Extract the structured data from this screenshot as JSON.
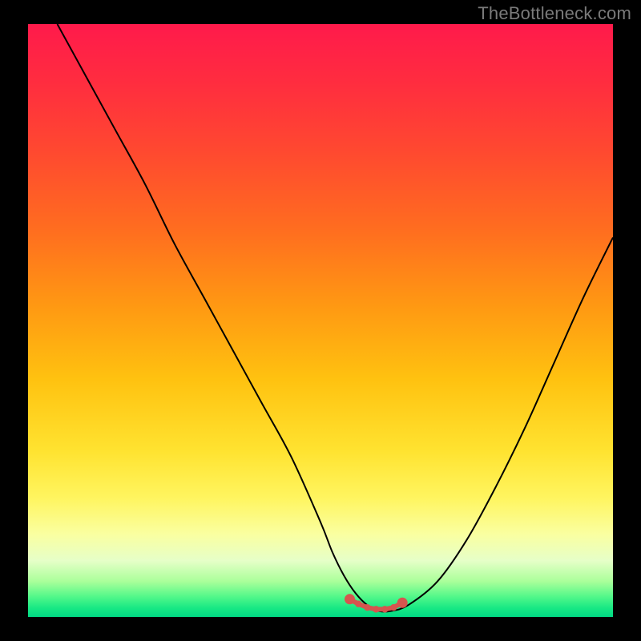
{
  "watermark": "TheBottleneck.com",
  "colors": {
    "frame": "#000000",
    "curve": "#000000",
    "marker_fill": "#d6554f",
    "marker_stroke": "#c23d32",
    "gradient": [
      {
        "offset": 0.0,
        "color": "#ff1a4b"
      },
      {
        "offset": 0.1,
        "color": "#ff2d3f"
      },
      {
        "offset": 0.22,
        "color": "#ff4a2f"
      },
      {
        "offset": 0.35,
        "color": "#ff6e1f"
      },
      {
        "offset": 0.48,
        "color": "#ff9a12"
      },
      {
        "offset": 0.6,
        "color": "#ffc210"
      },
      {
        "offset": 0.72,
        "color": "#ffe330"
      },
      {
        "offset": 0.8,
        "color": "#fff560"
      },
      {
        "offset": 0.86,
        "color": "#faffa0"
      },
      {
        "offset": 0.905,
        "color": "#e6ffc8"
      },
      {
        "offset": 0.94,
        "color": "#aaff9a"
      },
      {
        "offset": 0.965,
        "color": "#55f88a"
      },
      {
        "offset": 0.985,
        "color": "#18e884"
      },
      {
        "offset": 1.0,
        "color": "#00d884"
      }
    ]
  },
  "chart_data": {
    "type": "line",
    "title": "",
    "xlabel": "",
    "ylabel": "",
    "xlim": [
      0,
      100
    ],
    "ylim": [
      0,
      100
    ],
    "series": [
      {
        "name": "bottleneck-curve",
        "x": [
          5,
          10,
          15,
          20,
          25,
          30,
          35,
          40,
          45,
          50,
          52,
          54,
          56,
          58,
          60,
          62,
          65,
          70,
          75,
          80,
          85,
          90,
          95,
          100
        ],
        "y": [
          100,
          91,
          82,
          73,
          63,
          54,
          45,
          36,
          27,
          16,
          11,
          7,
          4,
          2,
          1,
          1,
          2,
          6,
          13,
          22,
          32,
          43,
          54,
          64
        ]
      }
    ],
    "annotations": {
      "optimal_range": {
        "x": [
          55,
          56.5,
          58,
          59.5,
          61,
          62.5,
          64
        ],
        "y": [
          3.0,
          2.2,
          1.6,
          1.3,
          1.3,
          1.6,
          2.4
        ]
      }
    }
  }
}
